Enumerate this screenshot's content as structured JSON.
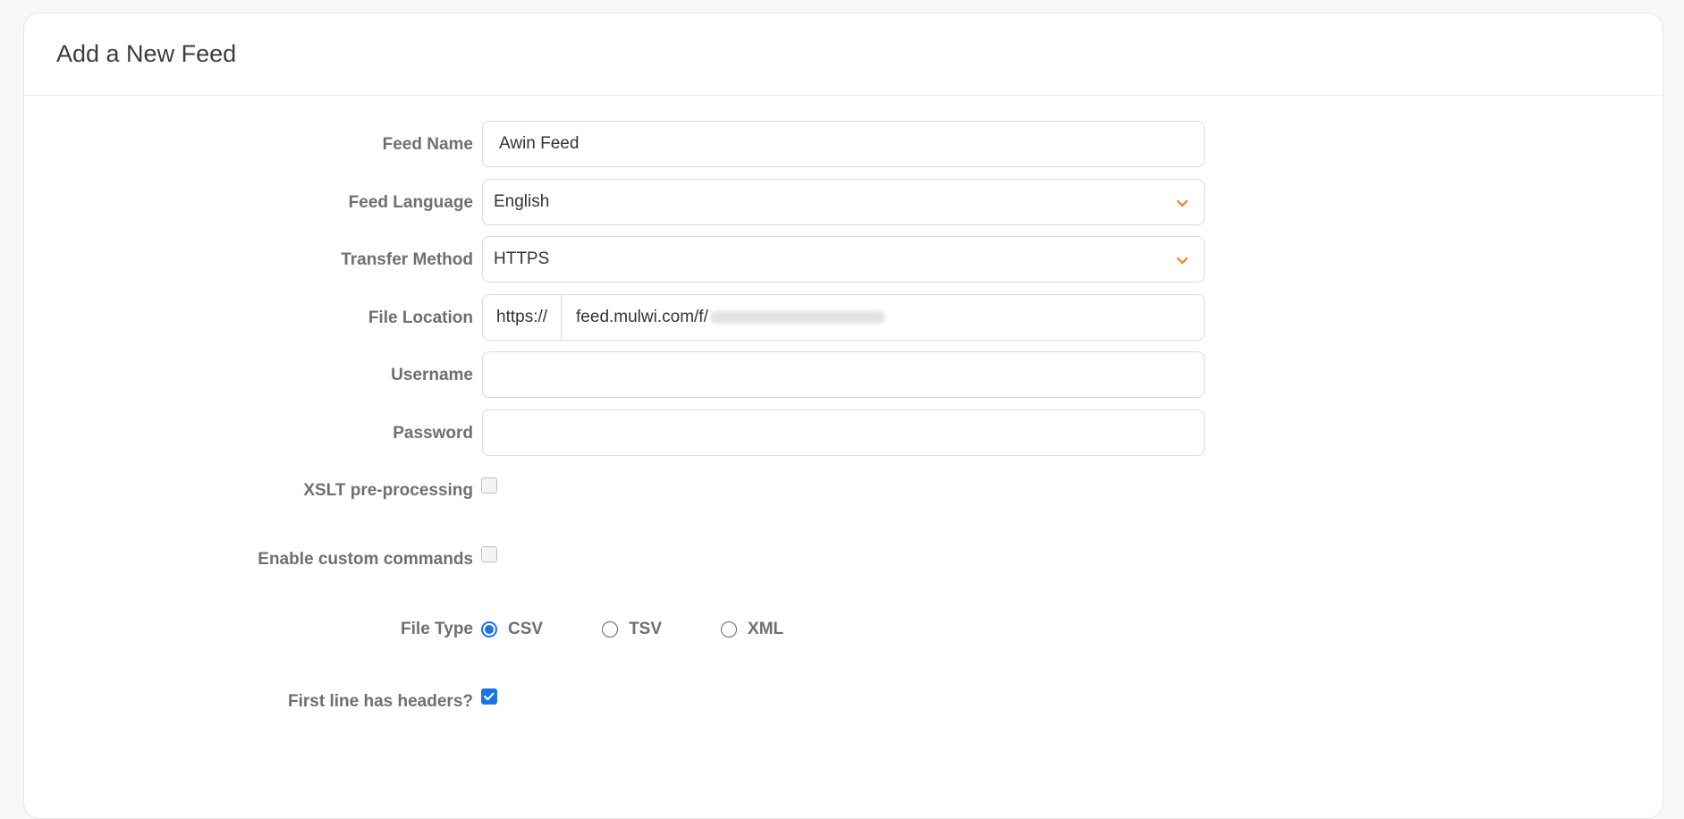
{
  "page": {
    "title": "Add a New Feed"
  },
  "form": {
    "feed_name": {
      "label": "Feed Name",
      "value": "Awin Feed"
    },
    "feed_language": {
      "label": "Feed Language",
      "value": "English",
      "icon": "chevron-down-icon"
    },
    "transfer_method": {
      "label": "Transfer Method",
      "value": "HTTPS",
      "icon": "chevron-down-icon"
    },
    "file_location": {
      "label": "File Location",
      "prefix": "https://",
      "value": "feed.mulwi.com/f/"
    },
    "username": {
      "label": "Username",
      "value": ""
    },
    "password": {
      "label": "Password",
      "value": ""
    },
    "xslt": {
      "label": "XSLT pre-processing",
      "checked": false
    },
    "custom_commands": {
      "label": "Enable custom commands",
      "checked": false
    },
    "file_type": {
      "label": "File Type",
      "options": [
        {
          "label": "CSV",
          "selected": true
        },
        {
          "label": "TSV",
          "selected": false
        },
        {
          "label": "XML",
          "selected": false
        }
      ]
    },
    "headers": {
      "label": "First line has headers?",
      "checked": true
    }
  },
  "colors": {
    "accent": "#1a73e8",
    "chevron": "#f28c38"
  }
}
